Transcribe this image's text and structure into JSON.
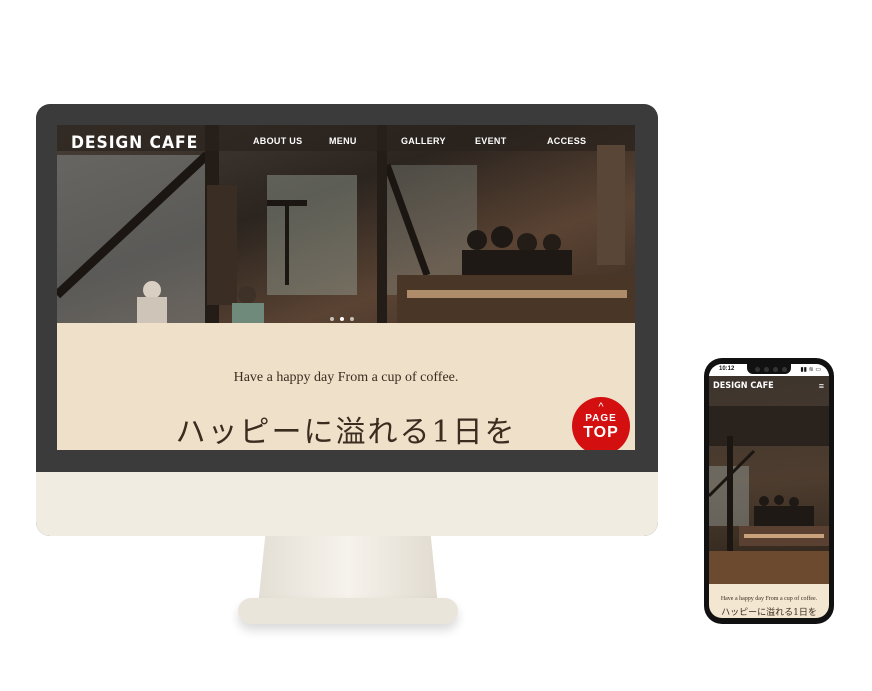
{
  "desktop": {
    "brand": "DESIGN CAFE",
    "nav": [
      {
        "label": "ABOUT US"
      },
      {
        "label": "MENU"
      },
      {
        "label": "GALLERY"
      },
      {
        "label": "EVENT"
      },
      {
        "label": "ACCESS"
      }
    ],
    "tagline": "Have a happy day From a cup of coffee.",
    "headline": "ハッピーに溢れる1日を",
    "page_top": {
      "line1": "PAGE",
      "line2": "TOP",
      "chevron": "^"
    },
    "slider_dots": 3,
    "slider_active": 1
  },
  "mobile": {
    "time": "10:12",
    "signal": "▮▮ ≋ ▭",
    "brand": "DESIGN CAFE",
    "menu_icon": "≡",
    "tagline": "Have a happy day From a cup of coffee.",
    "headline": "ハッピーに溢れる1日を"
  },
  "colors": {
    "cream": "#eee0c9",
    "text_brown": "#3a2d20",
    "page_top_red": "#d40f0f",
    "bezel": "#3b3b3b"
  }
}
